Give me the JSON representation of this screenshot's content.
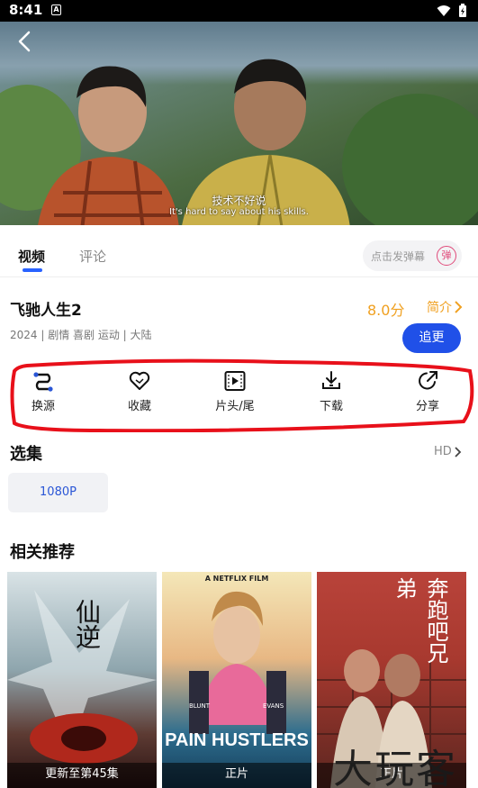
{
  "status": {
    "time": "8:41",
    "notif_letter": "A"
  },
  "video": {
    "subtitle_cn": "技术不好说",
    "subtitle_en": "It's hard to say about his skills."
  },
  "tabs": [
    {
      "label": "视频"
    },
    {
      "label": "评论"
    }
  ],
  "danmu": {
    "placeholder": "点击发弹幕",
    "icon_glyph": "弹"
  },
  "movie": {
    "title": "飞驰人生2",
    "score": "8.0分",
    "intro_label": "简介",
    "meta": "2024 | 剧情 喜剧 运动 | 大陆",
    "follow_label": "追更"
  },
  "actions": [
    {
      "label": "换源",
      "icon": "switch-source-icon"
    },
    {
      "label": "收藏",
      "icon": "heart-icon"
    },
    {
      "label": "片头/尾",
      "icon": "skip-intro-icon"
    },
    {
      "label": "下载",
      "icon": "download-icon"
    },
    {
      "label": "分享",
      "icon": "share-icon"
    }
  ],
  "episodes": {
    "title": "选集",
    "quality": "HD",
    "items": [
      {
        "label": "1080P"
      }
    ]
  },
  "related": {
    "title": "相关推荐",
    "items": [
      {
        "poster_title": "仙逆",
        "caption": "更新至第45集"
      },
      {
        "poster_title": "PAIN HUSTLERS",
        "poster_top": "A NETFLIX FILM",
        "poster_cast": [
          "BLUNT",
          "EVANS"
        ],
        "caption": "正片"
      },
      {
        "poster_title": "奔跑吧兄弟",
        "caption": "正片"
      }
    ]
  },
  "watermark": "大玩客",
  "colors": {
    "accent_blue": "#2050e8",
    "score_orange": "#f0a020",
    "highlight_red": "#e8101a"
  }
}
